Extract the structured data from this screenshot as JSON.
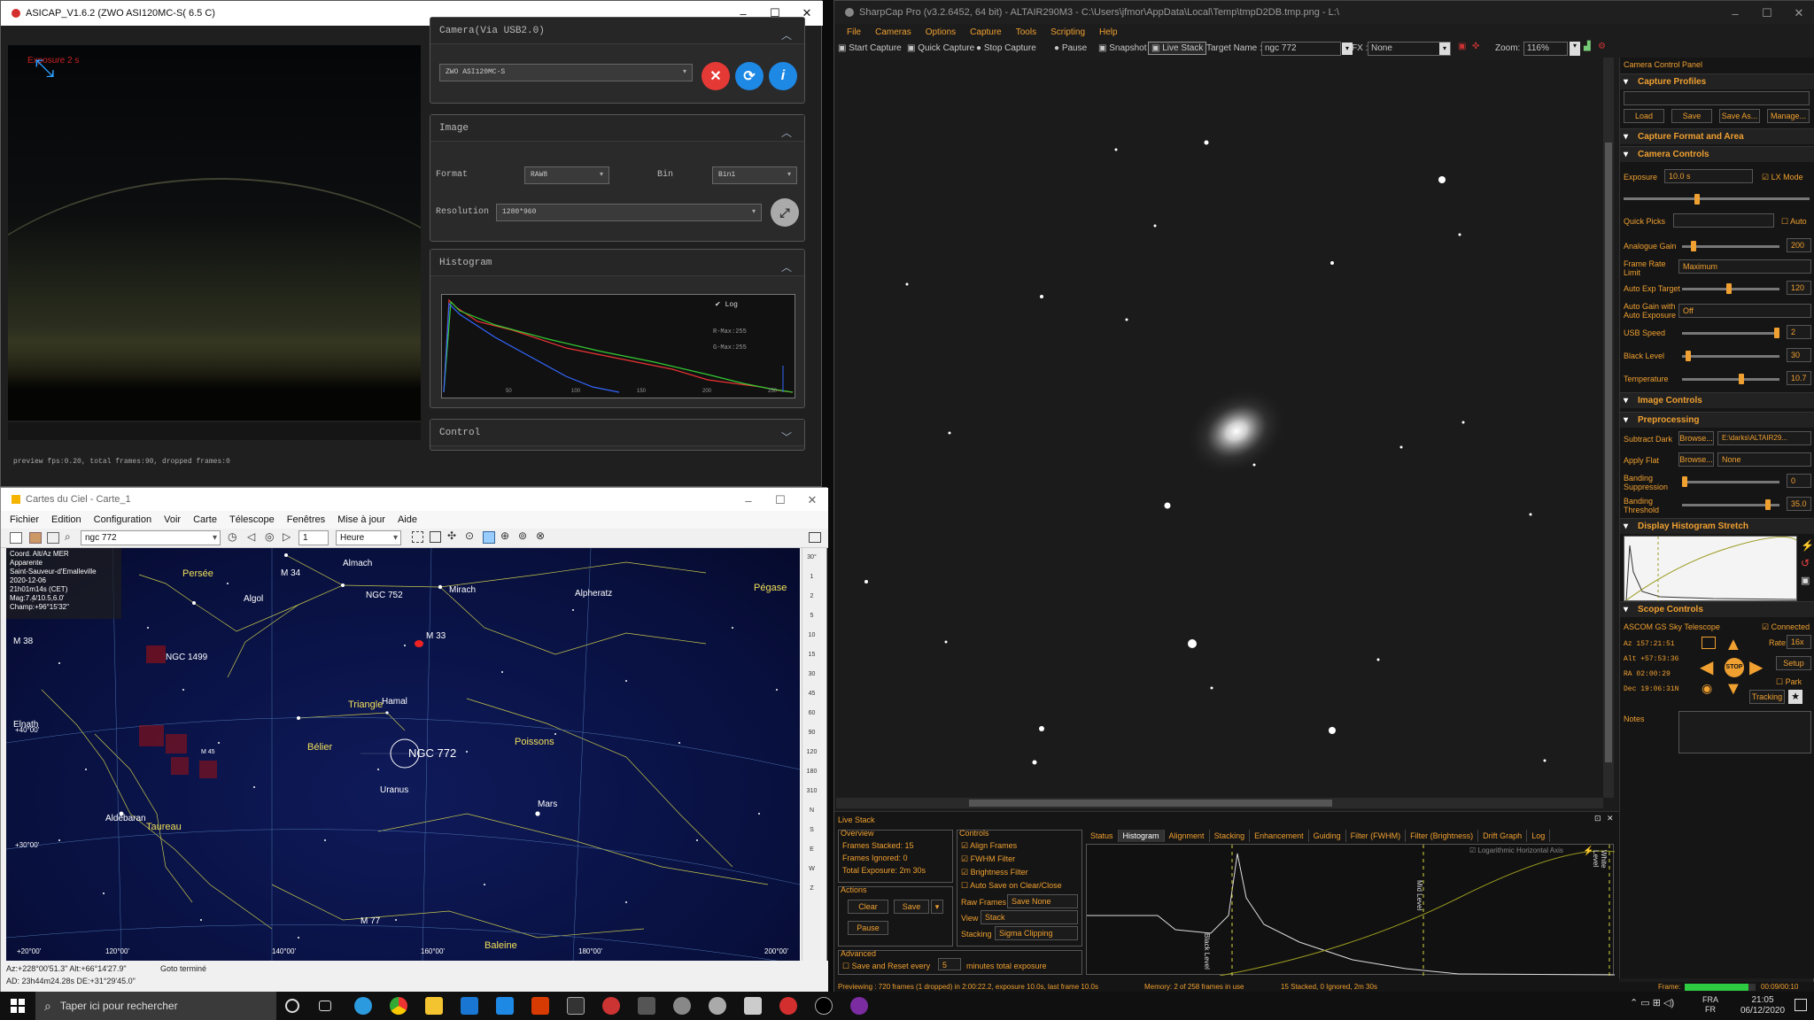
{
  "asicap": {
    "title": "ASICAP_V1.6.2 (ZWO ASI120MC-S( 6.5 C)",
    "preview_overlay": "Exposure 2 s",
    "footer": "preview fps:0.20, total frames:90, dropped frames:0",
    "camera": {
      "header": "Camera(Via USB2.0)",
      "selected": "ZWO ASI120MC-S"
    },
    "image": {
      "header": "Image",
      "format_label": "Format",
      "format_value": "RAW8",
      "bin_label": "Bin",
      "bin_value": "Bin1",
      "resolution_label": "Resolution",
      "resolution_value": "1280*960"
    },
    "histogram": {
      "header": "Histogram",
      "log_label": "Log",
      "rmax": "R-Max:255",
      "gmax": "G-Max:255",
      "ticks": [
        "50",
        "100",
        "150",
        "200",
        "250"
      ]
    },
    "control": {
      "header": "Control"
    }
  },
  "cdc": {
    "title": "Cartes du Ciel - Carte_1",
    "menu": [
      "Fichier",
      "Edition",
      "Configuration",
      "Voir",
      "Carte",
      "Télescope",
      "Fenêtres",
      "Mise à jour",
      "Aide"
    ],
    "search_value": "ngc 772",
    "step_value": "1",
    "time_unit": "Heure",
    "info_lines": [
      "Coord. Alt/Az MER",
      "Apparente",
      "Saint-Sauveur-d'Emalleville",
      "2020-12-06",
      "21h01m14s (CET)",
      "Mag:7.4/10.5,6.0'",
      "Champ:+96°15'32\""
    ],
    "labels_yellow": [
      "Persée",
      "Triangle",
      "Bélier",
      "Poissons",
      "Pégase",
      "Taureau",
      "Baleine"
    ],
    "labels_white": [
      "Almach",
      "M 34",
      "NGC 752",
      "Mirach",
      "Alpheratz",
      "Algol",
      "M 33",
      "NGC 1499",
      "M 38",
      "Elnath",
      "Hamal",
      "NGC 772",
      "M 45",
      "Uranus",
      "Mars",
      "Aldebaran",
      "M 77"
    ],
    "side_labels": [
      "30°",
      "1",
      "2",
      "5",
      "10",
      "15",
      "30",
      "45",
      "60",
      "90",
      "120",
      "180",
      "310",
      "N",
      "S",
      "E",
      "W",
      "Z"
    ],
    "axis_labels": [
      "+40°00'",
      "+30°00'",
      "+20°00'",
      "120°00'",
      "140°00'",
      "160°00'",
      "180°00'",
      "200°00'"
    ],
    "status_coords": "Az:+228°00'51.3\" Alt:+66°14'27.9\"",
    "status_radec": "AD: 23h44m24.28s DE:+31°29'45.0\"",
    "status_goto": "Goto terminé"
  },
  "sharpcap": {
    "title": "SharpCap Pro (v3.2.6452, 64 bit) - ALTAIR290M3 - C:\\Users\\jfmor\\AppData\\Local\\Temp\\tmpD2DB.tmp.png - L:\\",
    "menu": [
      "File",
      "Cameras",
      "Options",
      "Capture",
      "Tools",
      "Scripting",
      "Help"
    ],
    "toolbar": {
      "start": "Start Capture",
      "quick": "Quick Capture",
      "stop": "Stop Capture",
      "pause": "Pause",
      "snapshot": "Snapshot",
      "live_stack": "Live Stack",
      "target_label": "Target Name :",
      "target_value": "ngc 772",
      "fx_label": "FX :",
      "fx_value": "None",
      "zoom_label": "Zoom:",
      "zoom_value": "116%"
    },
    "panel": {
      "title": "Camera Control Panel",
      "capture_profiles": "Capture Profiles",
      "profile_buttons": [
        "Load",
        "Save",
        "Save As...",
        "Manage..."
      ],
      "format_area": "Capture Format and Area",
      "camera_controls": "Camera Controls",
      "exposure_label": "Exposure",
      "exposure_value": "10.0 s",
      "lx_mode": "LX Mode",
      "quick_picks": "Quick Picks",
      "auto": "Auto",
      "analogue_gain": "Analogue Gain",
      "analogue_gain_value": "200",
      "frame_rate_limit": "Frame Rate Limit",
      "frame_rate_value": "Maximum",
      "auto_exp_target": "Auto Exp Target",
      "auto_exp_value": "120",
      "auto_gain": "Auto Gain with Auto Exposure",
      "auto_gain_value": "Off",
      "usb_speed": "USB Speed",
      "usb_speed_value": "2",
      "black_level": "Black Level",
      "black_level_value": "30",
      "temperature": "Temperature",
      "temperature_value": "10.7",
      "image_controls": "Image Controls",
      "preprocessing": "Preprocessing",
      "subtract_dark": "Subtract Dark",
      "browse": "Browse...",
      "dark_path": "E:\\darks\\ALTAIR29...",
      "apply_flat": "Apply Flat",
      "flat_value": "None",
      "banding_suppression": "Banding Suppression",
      "banding_suppression_value": "0",
      "banding_threshold": "Banding Threshold",
      "banding_threshold_value": "35.0",
      "histogram_stretch": "Display Histogram Stretch",
      "scope_controls": "Scope Controls",
      "scope_name": "ASCOM GS Sky Telescope",
      "connected": "Connected",
      "az": "157:21:51",
      "alt": "+57:53:36",
      "ra": "02:00:29",
      "dec": "19:06:31N",
      "az_label": "Az",
      "alt_label": "Alt",
      "ra_label": "RA",
      "dec_label": "Dec",
      "rate_label": "Rate:",
      "rate_value": "16x",
      "setup": "Setup",
      "park": "Park",
      "tracking": "Tracking",
      "stop": "STOP",
      "notes": "Notes"
    },
    "live_stack": {
      "title": "Live Stack",
      "overview": "Overview",
      "frames_stacked": "Frames Stacked: 15",
      "frames_ignored": "Frames Ignored: 0",
      "total_exposure": "Total Exposure: 2m 30s",
      "actions": "Actions",
      "clear": "Clear",
      "save": "Save",
      "pause": "Pause",
      "controls": "Controls",
      "align": "Align Frames",
      "fwhm": "FWHM Filter",
      "brightness": "Brightness Filter",
      "auto_save": "Auto Save on Clear/Close",
      "raw_frames_label": "Raw Frames",
      "raw_frames_value": "Save None",
      "view_label": "View",
      "view_value": "Stack",
      "stacking_label": "Stacking",
      "stacking_value": "Sigma Clipping",
      "advanced": "Advanced",
      "save_reset": "Save and Reset every",
      "reset_value": "5",
      "minutes": "minutes total exposure",
      "tabs": [
        "Status",
        "Histogram",
        "Alignment",
        "Stacking",
        "Enhancement",
        "Guiding",
        "Filter (FWHM)",
        "Filter (Brightness)",
        "Drift Graph",
        "Log"
      ],
      "log_axis": "Logarithmic Horizontal Axis",
      "black_level": "Black Level",
      "mid_level": "Mid Level",
      "white_level": "White Level"
    },
    "statusbar": {
      "previewing": "Previewing : 720 frames (1 dropped) in 2:00:22.2, exposure 10.0s, last frame 10.0s",
      "memory": "Memory: 2 of 258 frames in use",
      "stacked": "15 Stacked, 0 Ignored, 2m 30s",
      "frame_label": "Frame:",
      "frame_time": "00:09/00:10"
    }
  },
  "taskbar": {
    "search_placeholder": "Taper ici pour rechercher",
    "lang1": "FRA",
    "lang2": "FR",
    "time": "21:05",
    "date": "06/12/2020"
  },
  "colors": {
    "sharpcap_accent": "#f0a030",
    "cdc_label": "#f1e05a",
    "asicap_red": "#e53935",
    "asicap_blue": "#1e88e5"
  }
}
